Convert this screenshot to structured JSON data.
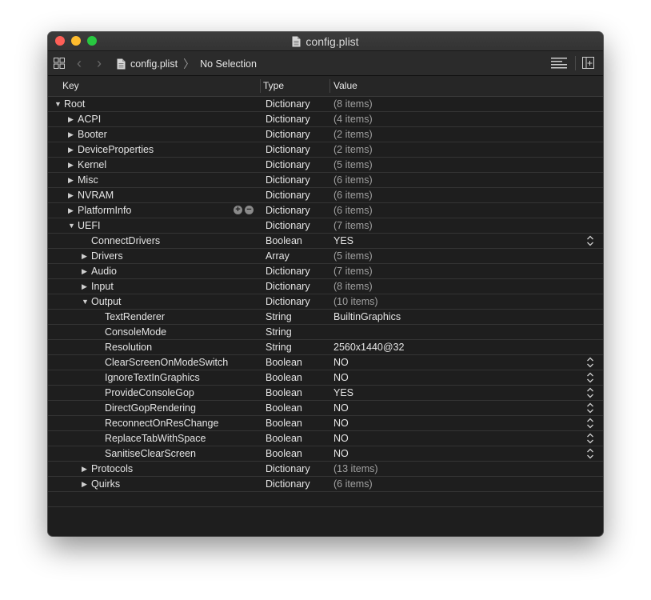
{
  "window": {
    "title": "config.plist"
  },
  "toolbar": {
    "file": "config.plist",
    "selection": "No Selection"
  },
  "columns": {
    "key": "Key",
    "type": "Type",
    "value": "Value"
  },
  "rows": [
    {
      "key": "Root",
      "type": "Dictionary",
      "value": "(8 items)",
      "indent": 0,
      "expander": "open"
    },
    {
      "key": "ACPI",
      "type": "Dictionary",
      "value": "(4 items)",
      "indent": 1,
      "expander": "closed"
    },
    {
      "key": "Booter",
      "type": "Dictionary",
      "value": "(2 items)",
      "indent": 1,
      "expander": "closed"
    },
    {
      "key": "DeviceProperties",
      "type": "Dictionary",
      "value": "(2 items)",
      "indent": 1,
      "expander": "closed"
    },
    {
      "key": "Kernel",
      "type": "Dictionary",
      "value": "(5 items)",
      "indent": 1,
      "expander": "closed"
    },
    {
      "key": "Misc",
      "type": "Dictionary",
      "value": "(6 items)",
      "indent": 1,
      "expander": "closed"
    },
    {
      "key": "NVRAM",
      "type": "Dictionary",
      "value": "(6 items)",
      "indent": 1,
      "expander": "closed"
    },
    {
      "key": "PlatformInfo",
      "type": "Dictionary",
      "value": "(6 items)",
      "indent": 1,
      "expander": "closed",
      "addremove": true
    },
    {
      "key": "UEFI",
      "type": "Dictionary",
      "value": "(7 items)",
      "indent": 1,
      "expander": "open"
    },
    {
      "key": "ConnectDrivers",
      "type": "Boolean",
      "value": "YES",
      "indent": 2,
      "expander": "none",
      "stepper": true
    },
    {
      "key": "Drivers",
      "type": "Array",
      "value": "(5 items)",
      "indent": 2,
      "expander": "closed"
    },
    {
      "key": "Audio",
      "type": "Dictionary",
      "value": "(7 items)",
      "indent": 2,
      "expander": "closed"
    },
    {
      "key": "Input",
      "type": "Dictionary",
      "value": "(8 items)",
      "indent": 2,
      "expander": "closed"
    },
    {
      "key": "Output",
      "type": "Dictionary",
      "value": "(10 items)",
      "indent": 2,
      "expander": "open"
    },
    {
      "key": "TextRenderer",
      "type": "String",
      "value": "BuiltinGraphics",
      "indent": 3,
      "expander": "none"
    },
    {
      "key": "ConsoleMode",
      "type": "String",
      "value": "",
      "indent": 3,
      "expander": "none"
    },
    {
      "key": "Resolution",
      "type": "String",
      "value": "2560x1440@32",
      "indent": 3,
      "expander": "none"
    },
    {
      "key": "ClearScreenOnModeSwitch",
      "type": "Boolean",
      "value": "NO",
      "indent": 3,
      "expander": "none",
      "stepper": true
    },
    {
      "key": "IgnoreTextInGraphics",
      "type": "Boolean",
      "value": "NO",
      "indent": 3,
      "expander": "none",
      "stepper": true
    },
    {
      "key": "ProvideConsoleGop",
      "type": "Boolean",
      "value": "YES",
      "indent": 3,
      "expander": "none",
      "stepper": true
    },
    {
      "key": "DirectGopRendering",
      "type": "Boolean",
      "value": "NO",
      "indent": 3,
      "expander": "none",
      "stepper": true
    },
    {
      "key": "ReconnectOnResChange",
      "type": "Boolean",
      "value": "NO",
      "indent": 3,
      "expander": "none",
      "stepper": true
    },
    {
      "key": "ReplaceTabWithSpace",
      "type": "Boolean",
      "value": "NO",
      "indent": 3,
      "expander": "none",
      "stepper": true
    },
    {
      "key": "SanitiseClearScreen",
      "type": "Boolean",
      "value": "NO",
      "indent": 3,
      "expander": "none",
      "stepper": true
    },
    {
      "key": "Protocols",
      "type": "Dictionary",
      "value": "(13 items)",
      "indent": 2,
      "expander": "closed"
    },
    {
      "key": "Quirks",
      "type": "Dictionary",
      "value": "(6 items)",
      "indent": 2,
      "expander": "closed"
    },
    {
      "key": "",
      "type": "",
      "value": "",
      "indent": 0,
      "expander": "none"
    }
  ],
  "colors": {
    "background": "#1e1e1e",
    "row_divider": "#343434",
    "muted_value": "#a0a0a0"
  },
  "icons": {
    "grid": "grid-icon",
    "back": "chevron-left-icon",
    "forward": "chevron-right-icon",
    "doc": "document-icon",
    "lines": "text-lines-icon",
    "panel": "sidebar-panel-icon"
  }
}
